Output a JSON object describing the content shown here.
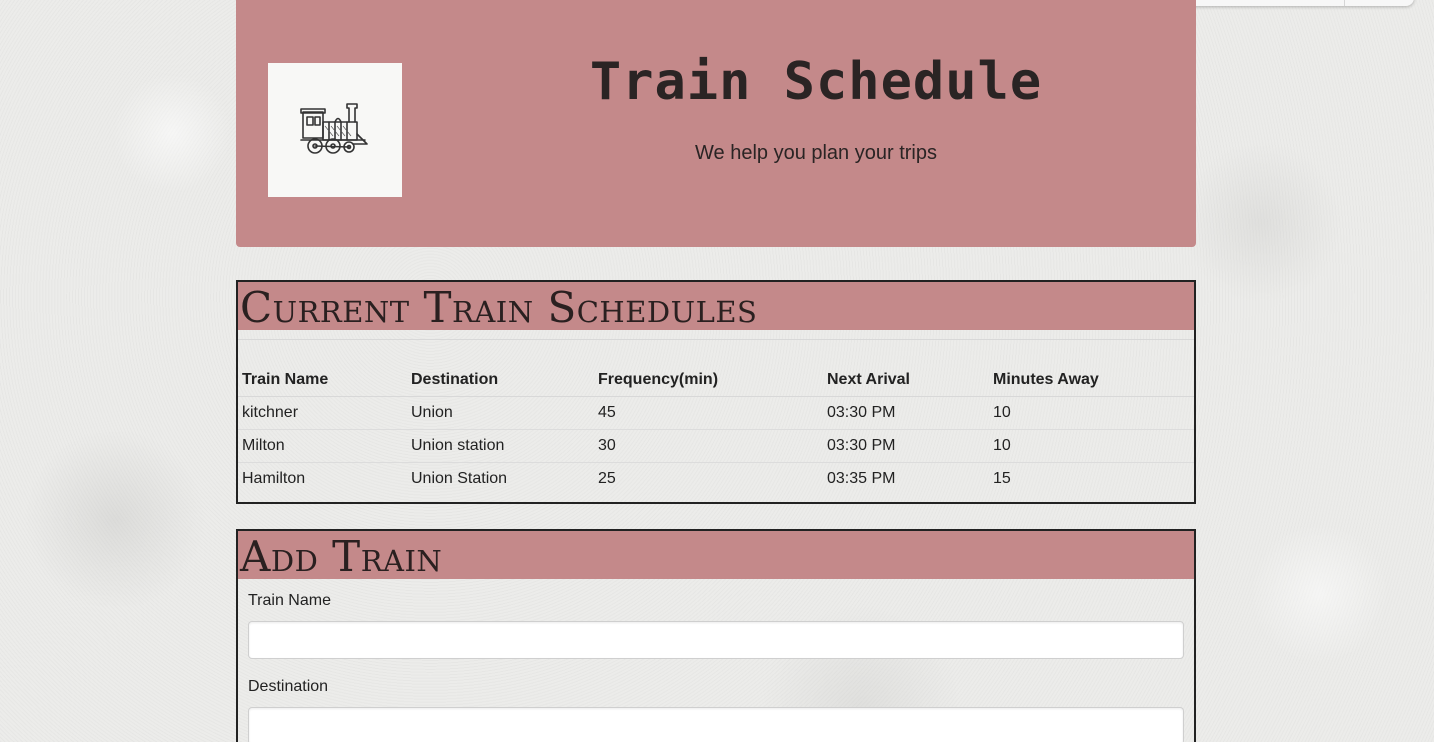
{
  "header": {
    "title": "Train Schedule",
    "subtitle": "We help you plan your trips",
    "logo_icon": "train-locomotive-icon"
  },
  "schedule": {
    "title": "Current Train Schedules",
    "columns": [
      "Train Name",
      "Destination",
      "Frequency(min)",
      "Next Arival",
      "Minutes Away"
    ],
    "rows": [
      [
        "kitchner",
        "Union",
        "45",
        "03:30 PM",
        "10"
      ],
      [
        "Milton",
        "Union station",
        "30",
        "03:30 PM",
        "10"
      ],
      [
        "Hamilton",
        "Union Station",
        "25",
        "03:35 PM",
        "15"
      ]
    ]
  },
  "add_train": {
    "title": "Add Train",
    "fields": [
      {
        "label": "Train Name",
        "value": "",
        "placeholder": ""
      },
      {
        "label": "Destination",
        "value": "",
        "placeholder": ""
      }
    ]
  },
  "colors": {
    "accent": "#c4898a",
    "text": "#222222",
    "border": "#222222"
  }
}
